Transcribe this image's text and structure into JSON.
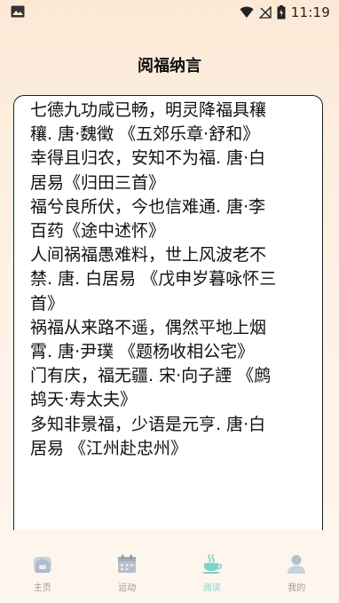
{
  "status_bar": {
    "time": "11:19"
  },
  "header": {
    "title": "阅福纳言"
  },
  "poem": {
    "lines": [
      "七德九功咸已畅，明灵降福具穰",
      "穰. 唐·魏徵 《五郊乐章·舒和》",
      "幸得且归农，安知不为福. 唐·白",
      "居易《归田三首》",
      "福兮良所伏，今也信难通. 唐·李",
      "百药《途中述怀》",
      "人间祸福愚难料，世上风波老不",
      "禁. 唐. 白居易 《戊申岁暮咏怀三",
      "首》",
      "祸福从来路不遥，偶然平地上烟",
      "霄. 唐·尹璞 《题杨收相公宅》",
      "门有庆，福无疆. 宋·向子諲 《鹧",
      "鸪天·寿太夫》",
      "多知非景福，少语是元亨. 唐·白",
      "居易 《江州赴忠州》"
    ]
  },
  "nav": {
    "items": [
      {
        "label": "主页",
        "icon": "home-icon",
        "active": false
      },
      {
        "label": "运动",
        "icon": "calendar-icon",
        "active": false
      },
      {
        "label": "阅读",
        "icon": "tea-cup-icon",
        "active": true
      },
      {
        "label": "我的",
        "icon": "person-icon",
        "active": false
      }
    ]
  },
  "colors": {
    "accent": "#7fd3cc",
    "inactive": "#9a9a9a"
  }
}
